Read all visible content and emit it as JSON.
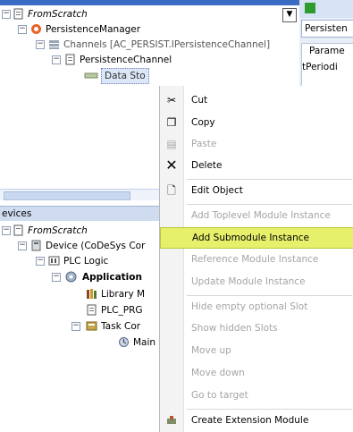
{
  "top_tree": {
    "root": "FromScratch",
    "persistence_manager": "PersistenceManager",
    "channels": "Channels [AC_PERSIST.IPersistenceChannel]",
    "persistence_channel": "PersistenceChannel",
    "data_storage_partial": "Data Sto"
  },
  "right_panel": {
    "tab_label": "Persisten",
    "column_header": "Parame",
    "cell_value": "tPeriodi"
  },
  "devices": {
    "header": "evices",
    "root": "FromScratch",
    "device": "Device (CoDeSys Cor",
    "plc_logic": "PLC Logic",
    "application": "Application",
    "library_manager": "Library M",
    "plc_prg": "PLC_PRG",
    "task_config": "Task Cor",
    "main_task": "Main"
  },
  "context_menu": {
    "items": [
      {
        "label": "Cut",
        "enabled": true,
        "icon": "scissors-icon"
      },
      {
        "label": "Copy",
        "enabled": true,
        "icon": "copy-icon"
      },
      {
        "label": "Paste",
        "enabled": false,
        "icon": "paste-icon"
      },
      {
        "label": "Delete",
        "enabled": true,
        "icon": "delete-icon"
      },
      {
        "label": "Edit Object",
        "enabled": true,
        "icon": "edit-object-icon"
      },
      {
        "label": "Add Toplevel Module Instance",
        "enabled": false
      },
      {
        "label": "Add Submodule Instance",
        "enabled": true,
        "highlighted": true
      },
      {
        "label": "Reference Module Instance",
        "enabled": false
      },
      {
        "label": "Update Module Instance",
        "enabled": false
      },
      {
        "label": "Hide empty optional Slot",
        "enabled": false
      },
      {
        "label": "Show hidden Slots",
        "enabled": false
      },
      {
        "label": "Move up",
        "enabled": false
      },
      {
        "label": "Move down",
        "enabled": false
      },
      {
        "label": "Go to target",
        "enabled": false
      },
      {
        "label": "Create Extension Module",
        "enabled": true,
        "icon": "extension-module-icon"
      }
    ]
  },
  "colors": {
    "highlight": "#e6f06b",
    "disabled_text": "#a4a4a4",
    "panel_border": "#9fb4d4"
  }
}
